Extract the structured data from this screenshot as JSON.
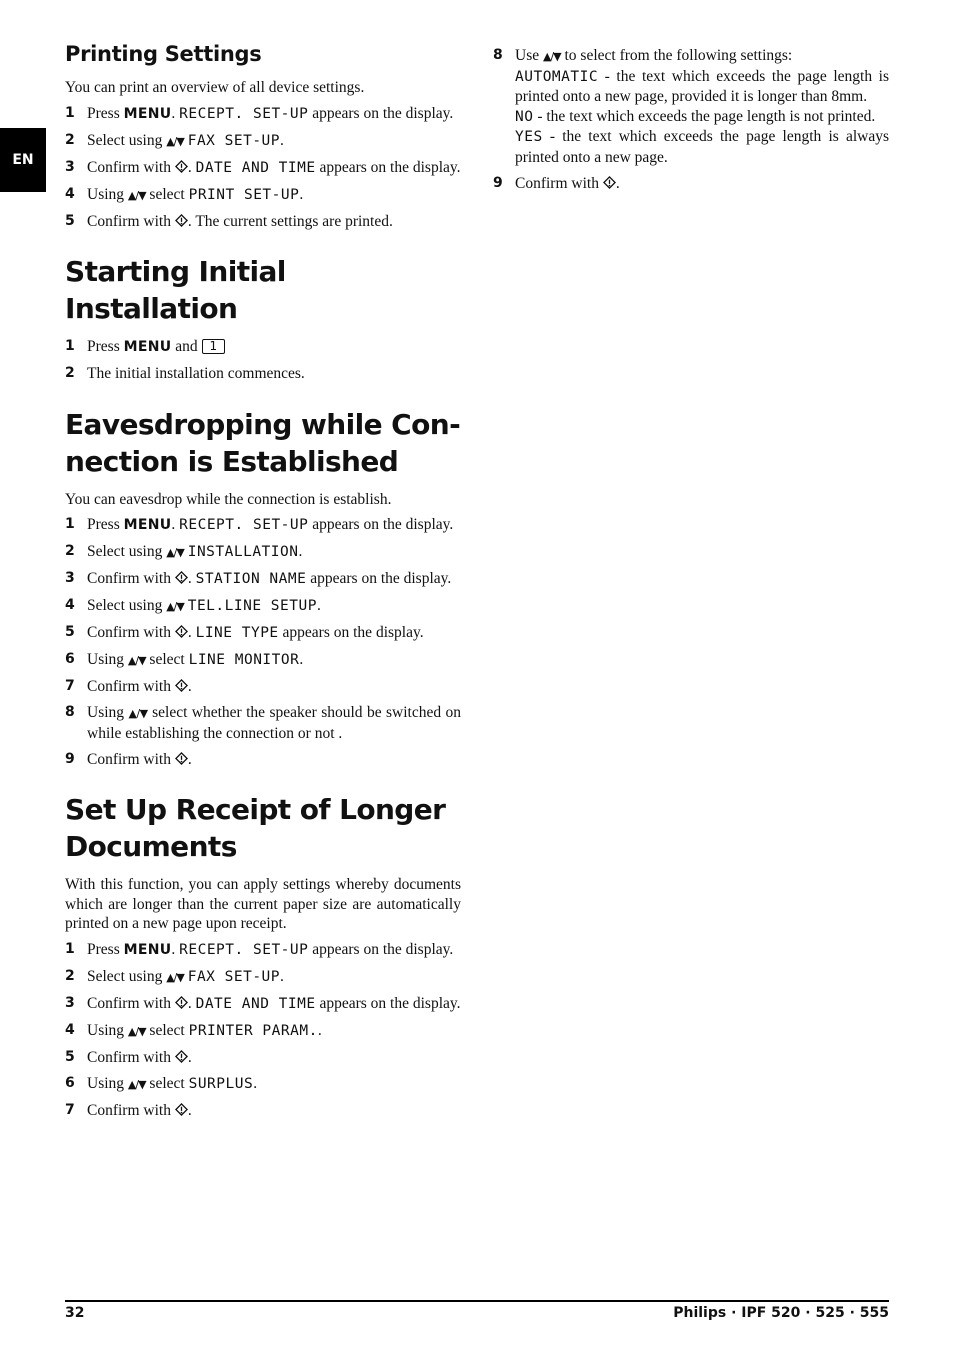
{
  "side_tab": {
    "label": "EN"
  },
  "icons": {
    "arrows": "▲/▼",
    "ok": "ok-icon"
  },
  "sections": [
    {
      "id": "printing-settings",
      "title": "Printing Settings",
      "intro": "You can print an overview of all device settings.",
      "steps": [
        {
          "n": "1",
          "seg": [
            [
              "t",
              "Press "
            ],
            [
              "k",
              "MENU"
            ],
            [
              "t",
              ". "
            ],
            [
              "d",
              "RECEPT.  SET-UP"
            ],
            [
              "t",
              " appears on the display."
            ]
          ]
        },
        {
          "n": "2",
          "seg": [
            [
              "t",
              "Select using "
            ],
            [
              "a",
              ""
            ],
            [
              "t",
              " "
            ],
            [
              "d",
              "FAX SET-UP"
            ],
            [
              "t",
              "."
            ]
          ]
        },
        {
          "n": "3",
          "seg": [
            [
              "t",
              "Confirm with "
            ],
            [
              "o",
              ""
            ],
            [
              "t",
              ". "
            ],
            [
              "d",
              "DATE AND TIME"
            ],
            [
              "t",
              " appears on the display."
            ]
          ]
        },
        {
          "n": "4",
          "seg": [
            [
              "t",
              "Using "
            ],
            [
              "a",
              ""
            ],
            [
              "t",
              " select "
            ],
            [
              "d",
              "PRINT SET-UP"
            ],
            [
              "t",
              "."
            ]
          ]
        },
        {
          "n": "5",
          "seg": [
            [
              "t",
              "Confirm with "
            ],
            [
              "o",
              ""
            ],
            [
              "t",
              ". The current settings are printed."
            ]
          ]
        }
      ]
    },
    {
      "id": "starting-initial-installation",
      "title": "Starting Initial Installation",
      "intro": "",
      "steps": [
        {
          "n": "1",
          "seg": [
            [
              "t",
              "Press "
            ],
            [
              "k",
              "MENU"
            ],
            [
              "t",
              " and "
            ],
            [
              "b",
              "1"
            ]
          ]
        },
        {
          "n": "2",
          "seg": [
            [
              "t",
              "The initial installation commences."
            ]
          ]
        }
      ]
    },
    {
      "id": "eavesdropping",
      "title": "Eavesdropping while Con-nection is Established",
      "title_lines": [
        "Eavesdropping while Con-",
        "nection is Established"
      ],
      "intro": "You can eavesdrop while the connection is establish.",
      "steps": [
        {
          "n": "1",
          "seg": [
            [
              "t",
              "Press "
            ],
            [
              "k",
              "MENU"
            ],
            [
              "t",
              ". "
            ],
            [
              "d",
              "RECEPT.  SET-UP"
            ],
            [
              "t",
              " appears on the display."
            ]
          ]
        },
        {
          "n": "2",
          "seg": [
            [
              "t",
              "Select using "
            ],
            [
              "a",
              ""
            ],
            [
              "t",
              " "
            ],
            [
              "d",
              "INSTALLATION"
            ],
            [
              "t",
              "."
            ]
          ]
        },
        {
          "n": "3",
          "seg": [
            [
              "t",
              "Confirm with "
            ],
            [
              "o",
              ""
            ],
            [
              "t",
              ". "
            ],
            [
              "d",
              "STATION NAME"
            ],
            [
              "t",
              " appears on the display."
            ]
          ]
        },
        {
          "n": "4",
          "seg": [
            [
              "t",
              "Select using "
            ],
            [
              "a",
              ""
            ],
            [
              "t",
              " "
            ],
            [
              "d",
              "TEL.LINE SETUP"
            ],
            [
              "t",
              "."
            ]
          ]
        },
        {
          "n": "5",
          "seg": [
            [
              "t",
              "Confirm with "
            ],
            [
              "o",
              ""
            ],
            [
              "t",
              ". "
            ],
            [
              "d",
              "LINE TYPE"
            ],
            [
              "t",
              " appears on the display."
            ]
          ]
        },
        {
          "n": "6",
          "seg": [
            [
              "t",
              "Using "
            ],
            [
              "a",
              ""
            ],
            [
              "t",
              " select "
            ],
            [
              "d",
              "LINE MONITOR"
            ],
            [
              "t",
              "."
            ]
          ]
        },
        {
          "n": "7",
          "seg": [
            [
              "t",
              "Confirm with "
            ],
            [
              "o",
              ""
            ],
            [
              "t",
              "."
            ]
          ]
        },
        {
          "n": "8",
          "seg": [
            [
              "t",
              "Using "
            ],
            [
              "a",
              ""
            ],
            [
              "t",
              " select whether the speaker should be switched on while establishing the connection or not ."
            ]
          ]
        },
        {
          "n": "9",
          "seg": [
            [
              "t",
              "Confirm with "
            ],
            [
              "o",
              ""
            ],
            [
              "t",
              "."
            ]
          ]
        }
      ]
    },
    {
      "id": "set-up-receipt-longer-documents",
      "title": "Set Up Receipt of Longer Documents",
      "title_lines": [
        "Set Up Receipt of Longer",
        "Documents"
      ],
      "intro": "With this function, you can apply settings whereby documents which are longer than the current paper size are automatically printed on a new page upon receipt.",
      "steps": [
        {
          "n": "1",
          "seg": [
            [
              "t",
              "Press "
            ],
            [
              "k",
              "MENU"
            ],
            [
              "t",
              ". "
            ],
            [
              "d",
              "RECEPT.  SET-UP"
            ],
            [
              "t",
              " appears on the display."
            ]
          ]
        },
        {
          "n": "2",
          "seg": [
            [
              "t",
              "Select using "
            ],
            [
              "a",
              ""
            ],
            [
              "t",
              " "
            ],
            [
              "d",
              "FAX SET-UP"
            ],
            [
              "t",
              "."
            ]
          ]
        },
        {
          "n": "3",
          "seg": [
            [
              "t",
              "Confirm with "
            ],
            [
              "o",
              ""
            ],
            [
              "t",
              ". "
            ],
            [
              "d",
              "DATE AND TIME"
            ],
            [
              "t",
              " appears on the display."
            ]
          ]
        },
        {
          "n": "4",
          "seg": [
            [
              "t",
              "Using "
            ],
            [
              "a",
              ""
            ],
            [
              "t",
              " select "
            ],
            [
              "d",
              "PRINTER PARAM."
            ],
            [
              "t",
              "."
            ]
          ]
        },
        {
          "n": "5",
          "seg": [
            [
              "t",
              "Confirm with "
            ],
            [
              "o",
              ""
            ],
            [
              "t",
              "."
            ]
          ]
        },
        {
          "n": "6",
          "seg": [
            [
              "t",
              "Using "
            ],
            [
              "a",
              ""
            ],
            [
              "t",
              " select "
            ],
            [
              "d",
              "SURPLUS"
            ],
            [
              "t",
              "."
            ]
          ]
        },
        {
          "n": "7",
          "seg": [
            [
              "t",
              "Confirm with "
            ],
            [
              "o",
              ""
            ],
            [
              "t",
              "."
            ]
          ]
        }
      ],
      "continued_steps": [
        {
          "n": "8",
          "seg": [
            [
              "t",
              "Use "
            ],
            [
              "a",
              ""
            ],
            [
              "t",
              " to select from the following settings:"
            ]
          ],
          "options": [
            [
              [
                "d",
                "AUTOMATIC"
              ],
              [
                "t",
                " - the text which exceeds the page length is printed onto a new page, provided it is longer than 8mm."
              ]
            ],
            [
              [
                "d",
                "NO"
              ],
              [
                "t",
                " - the text which exceeds the page length is not printed."
              ]
            ],
            [
              [
                "d",
                "YES"
              ],
              [
                "t",
                " - the text which exceeds the page length is always printed onto a new page."
              ]
            ]
          ]
        },
        {
          "n": "9",
          "seg": [
            [
              "t",
              "Confirm with "
            ],
            [
              "o",
              ""
            ],
            [
              "t",
              "."
            ]
          ]
        }
      ]
    }
  ],
  "footer": {
    "page_number": "32",
    "product": "Philips · IPF 520 · 525 · 555"
  }
}
